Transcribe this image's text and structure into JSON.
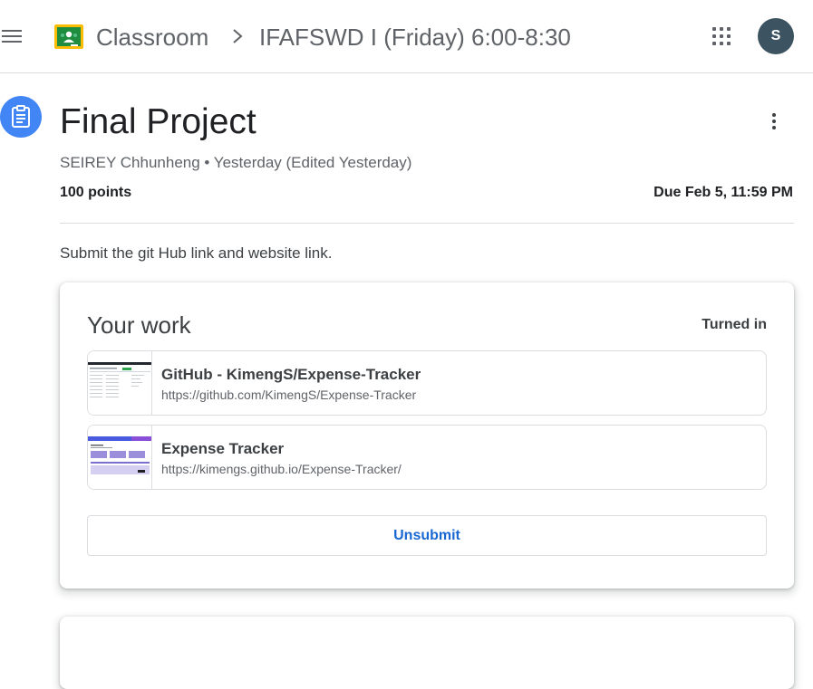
{
  "header": {
    "app_title": "Classroom",
    "class_name": "IFAFSWD I (Friday) 6:00-8:30",
    "avatar_initial": "S"
  },
  "assignment": {
    "title": "Final Project",
    "author": "SEIREY Chhunheng",
    "meta_sep": "•",
    "posted": "Yesterday (Edited Yesterday)",
    "points": "100 points",
    "due": "Due Feb 5, 11:59 PM",
    "instructions": "Submit the git Hub link and website link."
  },
  "your_work": {
    "title": "Your work",
    "status": "Turned in",
    "attachments": [
      {
        "title": "GitHub - KimengS/Expense-Tracker",
        "url": "https://github.com/KimengS/Expense-Tracker"
      },
      {
        "title": "Expense Tracker",
        "url": "https://kimengs.github.io/Expense-Tracker/"
      }
    ],
    "unsubmit_label": "Unsubmit"
  },
  "colors": {
    "accent_blue": "#4285f4",
    "link_blue": "#1967d2",
    "avatar_bg": "#3c5361",
    "logo_green": "#1e8e3e",
    "logo_yellow": "#fbbc04"
  },
  "icons": {
    "menu": "hamburger-menu-icon",
    "logo": "classroom-logo-icon",
    "breadcrumb": "chevron-right-icon",
    "apps": "apps-grid-icon",
    "assignment": "assignment-clipboard-icon",
    "more": "more-vert-icon"
  }
}
